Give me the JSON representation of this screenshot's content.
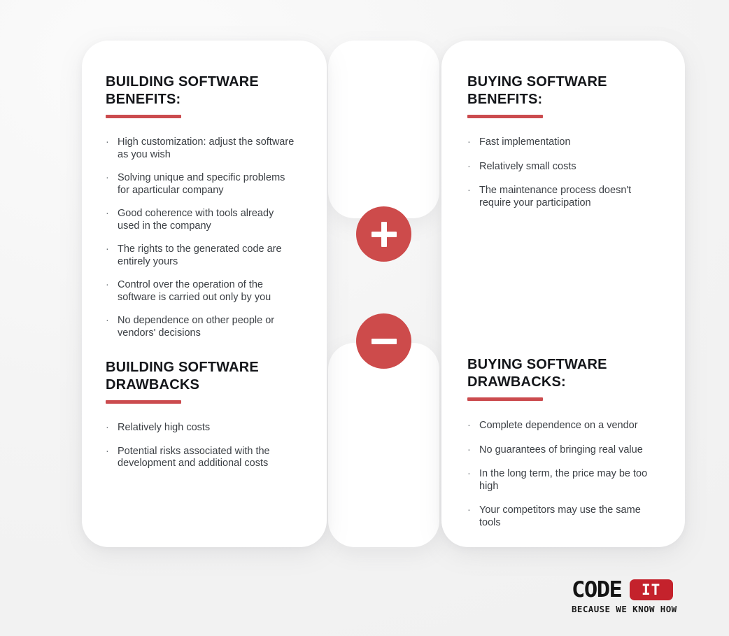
{
  "theme": {
    "background": "#f4f4f4",
    "card_background": "#ffffff",
    "accent_red": "#cb4b4e",
    "badge_red": "#cd4b4b",
    "logo_red": "#c4222c",
    "title_color": "#14161a",
    "body_color": "#3c4045"
  },
  "sections": {
    "build_benefits": {
      "title": "BUILDING SOFTWARE\nBENEFITS:",
      "bullets": [
        "High customization: adjust the software as you wish",
        "Solving unique and specific problems for aparticular company",
        "Good coherence with tools already used in the company",
        "The rights to the generated code are entirely yours",
        "Control over the operation of the software is carried out only by you",
        "No dependence on other people or vendors' decisions"
      ]
    },
    "build_drawbacks": {
      "title": "BUILDING SOFTWARE\nDRAWBACKS",
      "bullets": [
        "Relatively high costs",
        "Potential risks associated with the development and additional costs"
      ]
    },
    "buy_benefits": {
      "title": "BUYING SOFTWARE\nBENEFITS:",
      "bullets": [
        "Fast implementation",
        "Relatively small costs",
        "The maintenance process doesn't require your participation"
      ]
    },
    "buy_drawbacks": {
      "title": "BUYING SOFTWARE\nDRAWBACKS:",
      "bullets": [
        "Complete dependence on a vendor",
        "No guarantees of bringing real value",
        "In the long term, the price may be too high",
        "Your competitors may use the same tools"
      ]
    }
  },
  "badges": {
    "plus": "plus-icon",
    "minus": "minus-icon"
  },
  "bullet_glyph": "·",
  "logo": {
    "word_mark": "CODE",
    "badge_text": "IT",
    "tagline": "BECAUSE WE KNOW HOW"
  }
}
